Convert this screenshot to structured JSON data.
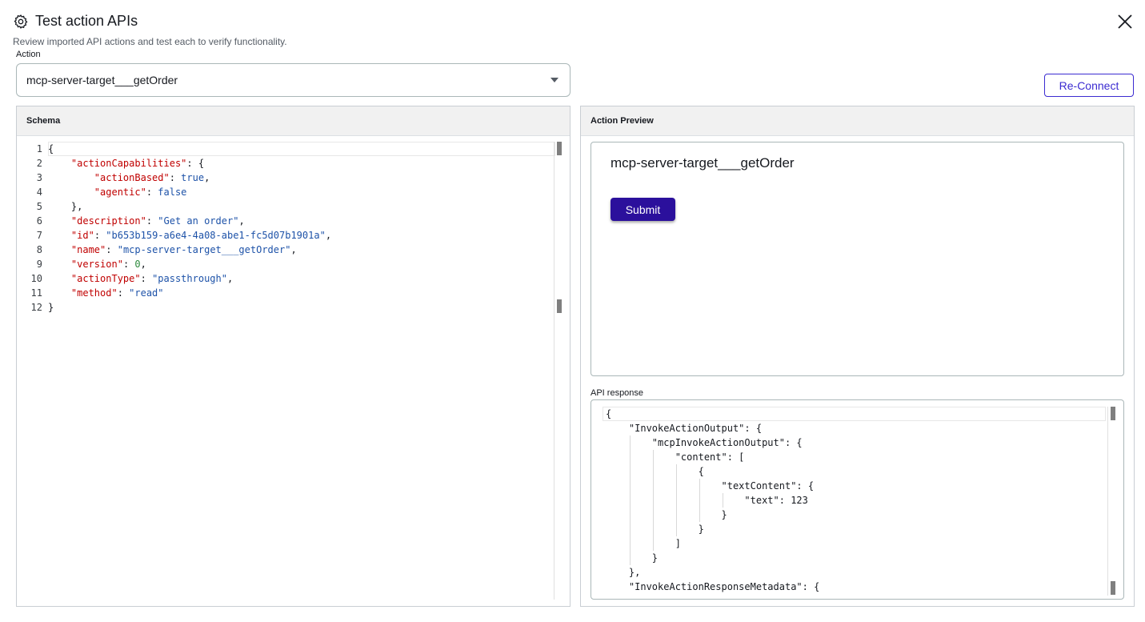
{
  "header": {
    "title": "Test action APIs",
    "subtitle": "Review imported API actions and test each to verify functionality.",
    "icon": "gear-icon",
    "close_icon": "close-icon"
  },
  "action": {
    "label": "Action",
    "selected": "mcp-server-target___getOrder"
  },
  "reconnect_label": "Re-Connect",
  "schema": {
    "title": "Schema",
    "line_numbers": [
      "1",
      "2",
      "3",
      "4",
      "5",
      "6",
      "7",
      "8",
      "9",
      "10",
      "11",
      "12"
    ],
    "lines": [
      [
        [
          "p",
          "{"
        ]
      ],
      [
        [
          "p",
          "    "
        ],
        [
          "k",
          "\"actionCapabilities\""
        ],
        [
          "p",
          ": {"
        ]
      ],
      [
        [
          "p",
          "        "
        ],
        [
          "k",
          "\"actionBased\""
        ],
        [
          "p",
          ": "
        ],
        [
          "b",
          "true"
        ],
        [
          "p",
          ","
        ]
      ],
      [
        [
          "p",
          "        "
        ],
        [
          "k",
          "\"agentic\""
        ],
        [
          "p",
          ": "
        ],
        [
          "b",
          "false"
        ]
      ],
      [
        [
          "p",
          "    },"
        ]
      ],
      [
        [
          "p",
          "    "
        ],
        [
          "k",
          "\"description\""
        ],
        [
          "p",
          ": "
        ],
        [
          "s",
          "\"Get an order\""
        ],
        [
          "p",
          ","
        ]
      ],
      [
        [
          "p",
          "    "
        ],
        [
          "k",
          "\"id\""
        ],
        [
          "p",
          ": "
        ],
        [
          "s",
          "\"b653b159-a6e4-4a08-abe1-fc5d07b1901a\""
        ],
        [
          "p",
          ","
        ]
      ],
      [
        [
          "p",
          "    "
        ],
        [
          "k",
          "\"name\""
        ],
        [
          "p",
          ": "
        ],
        [
          "s",
          "\"mcp-server-target___getOrder\""
        ],
        [
          "p",
          ","
        ]
      ],
      [
        [
          "p",
          "    "
        ],
        [
          "k",
          "\"version\""
        ],
        [
          "p",
          ": "
        ],
        [
          "n",
          "0"
        ],
        [
          "p",
          ","
        ]
      ],
      [
        [
          "p",
          "    "
        ],
        [
          "k",
          "\"actionType\""
        ],
        [
          "p",
          ": "
        ],
        [
          "s",
          "\"passthrough\""
        ],
        [
          "p",
          ","
        ]
      ],
      [
        [
          "p",
          "    "
        ],
        [
          "k",
          "\"method\""
        ],
        [
          "p",
          ": "
        ],
        [
          "s",
          "\"read\""
        ]
      ],
      [
        [
          "p",
          "}"
        ]
      ]
    ]
  },
  "preview": {
    "title": "Action Preview",
    "action_name": "mcp-server-target___getOrder",
    "submit_label": "Submit"
  },
  "api_response": {
    "label": "API response",
    "lines": [
      "{",
      "    \"InvokeActionOutput\": {",
      "        \"mcpInvokeActionOutput\": {",
      "            \"content\": [",
      "                {",
      "                    \"textContent\": {",
      "                        \"text\": 123",
      "                    }",
      "                }",
      "            ]",
      "        }",
      "    },",
      "    \"InvokeActionResponseMetadata\": {"
    ]
  }
}
